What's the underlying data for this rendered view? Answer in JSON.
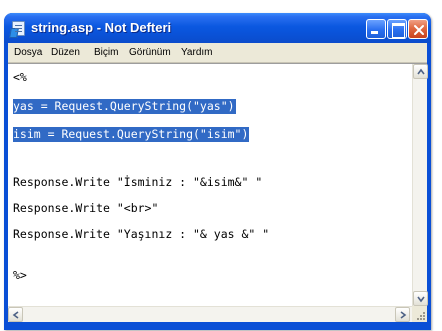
{
  "window": {
    "title": "string.asp - Not Defteri",
    "icon": "notepad-icon",
    "controls": [
      "minimize-icon",
      "maximize-icon",
      "close-icon"
    ]
  },
  "menu": {
    "items": [
      {
        "label": "Dosya"
      },
      {
        "label": "Düzen"
      },
      {
        "label": "Biçim"
      },
      {
        "label": "Görünüm"
      },
      {
        "label": "Yardım"
      }
    ]
  },
  "editor": {
    "lines": [
      {
        "text": "<%",
        "selected": false
      },
      {
        "text": "yas = Request.QueryString(\"yas\")",
        "selected": true
      },
      {
        "text": "isim = Request.QueryString(\"isim\")",
        "selected": true
      },
      {
        "text": "Response.Write \"İsminiz : \"&isim&\" \"",
        "selected": false
      },
      {
        "text": "Response.Write \"<br>\"",
        "selected": false
      },
      {
        "text": "Response.Write \"Yaşınız : \"& yas &\" \"",
        "selected": false
      },
      {
        "text": "%>",
        "selected": false
      }
    ]
  },
  "colors": {
    "title_bar": "#0a52d8",
    "selection": "#316ac5",
    "menu_bg": "#ece9d8",
    "close_button": "#e06a42"
  }
}
